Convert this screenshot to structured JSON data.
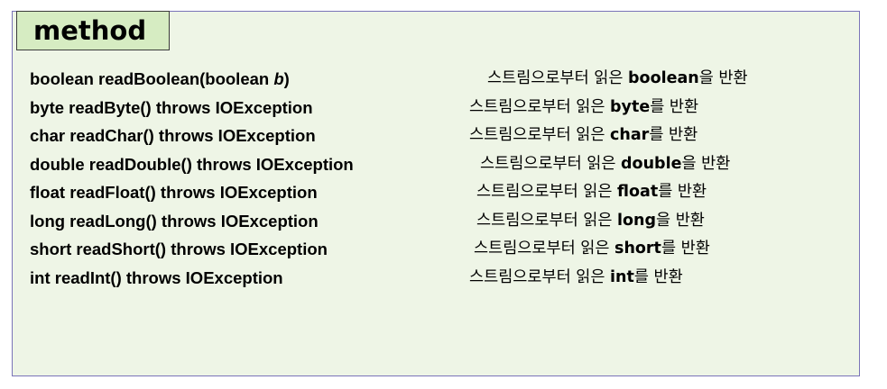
{
  "title": "method",
  "methods": [
    {
      "sig_pre": "boolean readBoolean(boolean ",
      "sig_param": "b",
      "sig_post": ")",
      "desc_pre": "스트림으로부터 읽은 ",
      "desc_type": "boolean",
      "desc_post": "을 반환"
    },
    {
      "sig_pre": "byte readByte() throws IOException",
      "sig_param": "",
      "sig_post": "",
      "desc_pre": "스트림으로부터 읽은 ",
      "desc_type": "byte",
      "desc_post": "를 반환"
    },
    {
      "sig_pre": "char readChar() throws IOException",
      "sig_param": "",
      "sig_post": "",
      "desc_pre": "스트림으로부터 읽은 ",
      "desc_type": "char",
      "desc_post": "를 반환"
    },
    {
      "sig_pre": "double readDouble() throws IOException",
      "sig_param": "",
      "sig_post": "",
      "desc_pre": "스트림으로부터 읽은 ",
      "desc_type": "double",
      "desc_post": "을 반환"
    },
    {
      "sig_pre": "float readFloat() throws IOException",
      "sig_param": "",
      "sig_post": "",
      "desc_pre": "스트림으로부터 읽은 ",
      "desc_type": "float",
      "desc_post": "를 반환"
    },
    {
      "sig_pre": "long readLong() throws IOException",
      "sig_param": "",
      "sig_post": "",
      "desc_pre": "스트림으로부터 읽은 ",
      "desc_type": "long",
      "desc_post": "을 반환"
    },
    {
      "sig_pre": "short readShort() throws IOException",
      "sig_param": "",
      "sig_post": "",
      "desc_pre": "스트림으로부터 읽은 ",
      "desc_type": "short",
      "desc_post": "를 반환"
    },
    {
      "sig_pre": "int readInt() throws IOException",
      "sig_param": "",
      "sig_post": "",
      "desc_pre": "스트림으로부터 읽은 ",
      "desc_type": "int",
      "desc_post": "를 반환"
    }
  ]
}
